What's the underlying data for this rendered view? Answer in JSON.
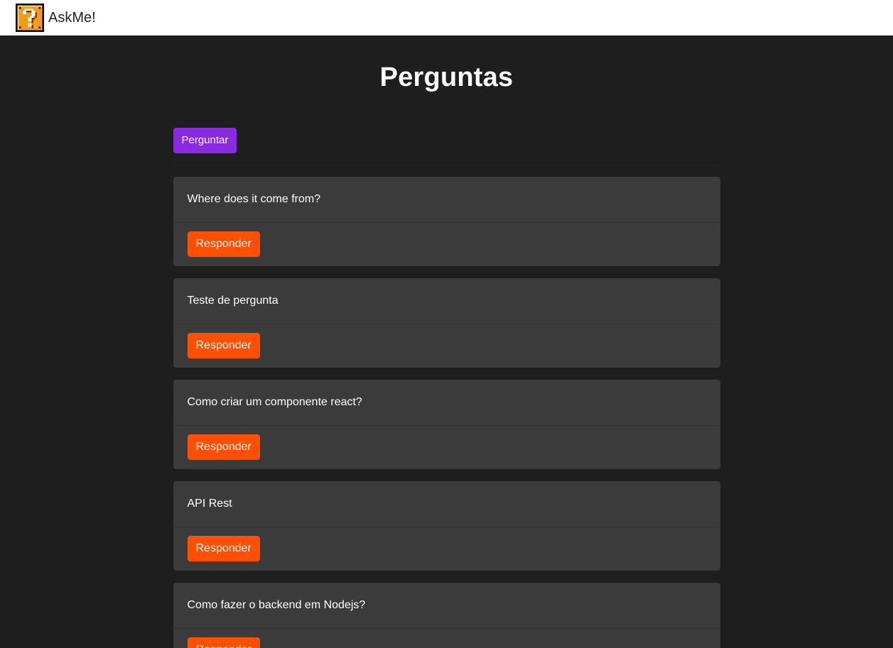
{
  "header": {
    "brand": "AskMe!",
    "logo_icon": "question-block-icon"
  },
  "main": {
    "title": "Perguntas",
    "ask_button": "Perguntar"
  },
  "questions": [
    {
      "text": "Where does it come from?",
      "answer_button": "Responder"
    },
    {
      "text": "Teste de pergunta",
      "answer_button": "Responder"
    },
    {
      "text": "Como criar um componente react?",
      "answer_button": "Responder"
    },
    {
      "text": "API Rest",
      "answer_button": "Responder"
    },
    {
      "text": "Como fazer o backend em Nodejs?",
      "answer_button": "Responder"
    }
  ],
  "colors": {
    "background": "#1e1e1e",
    "card": "#3b3b3b",
    "ask_button": "#8a2be2",
    "answer_button": "#ff4f00",
    "navbar": "#ffffff"
  }
}
